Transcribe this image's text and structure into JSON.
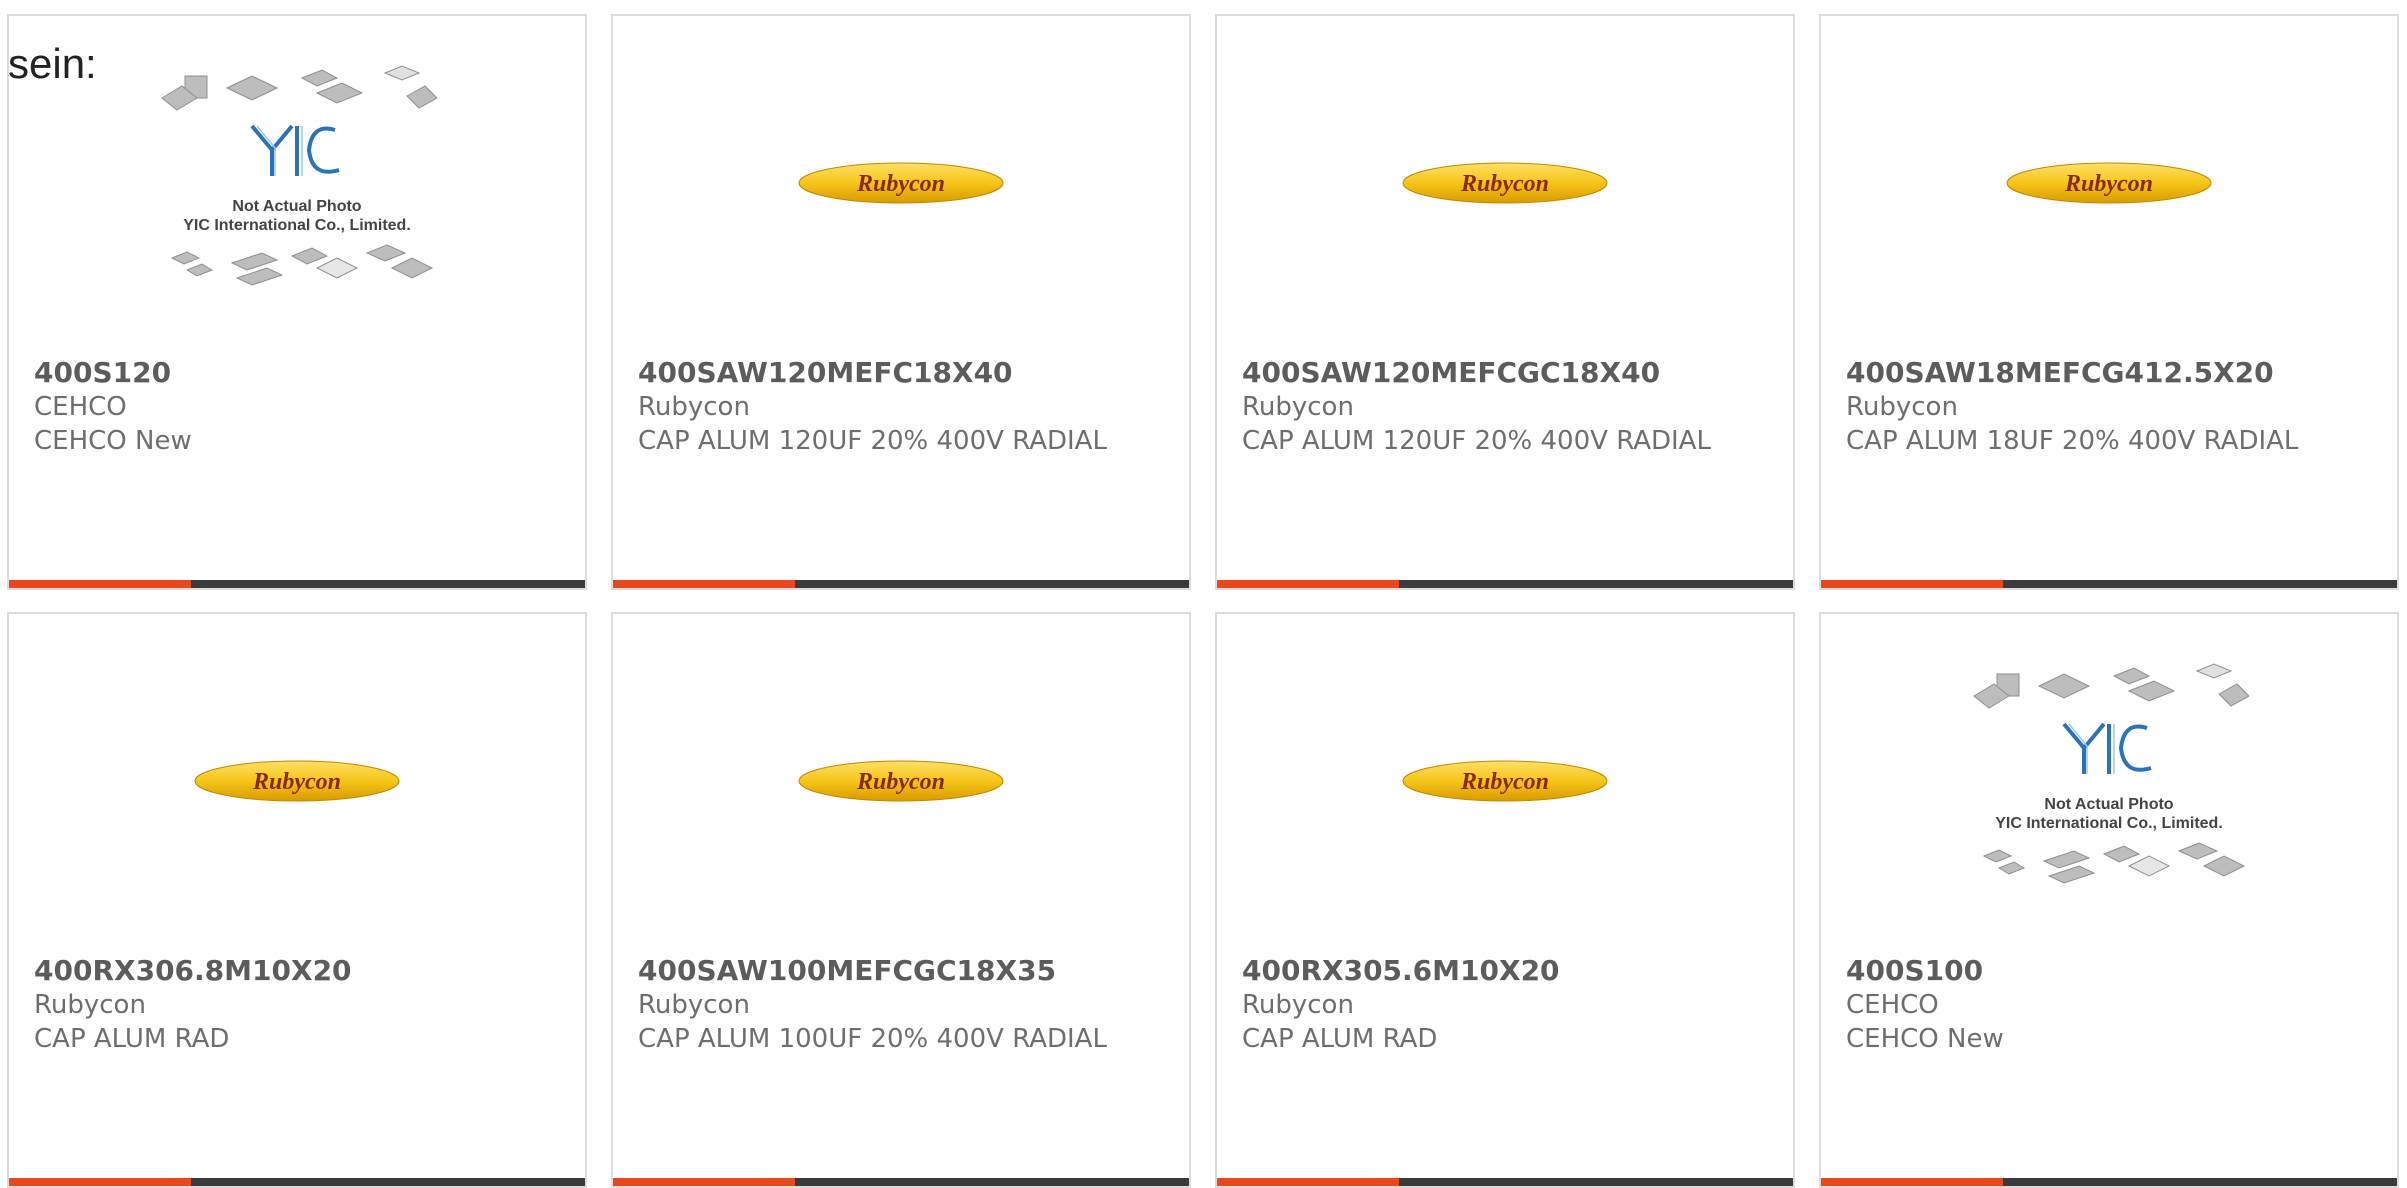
{
  "page": {
    "label": "sein:"
  },
  "colors": {
    "accent": "#e8481c",
    "bar": "#3b3b3b",
    "rubycon_yellow": "#f5c518",
    "rubycon_text": "#8a2a12",
    "yic_blue": "#2b73b8"
  },
  "products": [
    {
      "part_number": "400S120",
      "manufacturer": "CEHCO",
      "description": "CEHCO New",
      "image": "yic-placeholder"
    },
    {
      "part_number": "400SAW120MEFC18X40",
      "manufacturer": "Rubycon",
      "description": "CAP ALUM 120UF 20% 400V RADIAL",
      "image": "rubycon-logo"
    },
    {
      "part_number": "400SAW120MEFCGC18X40",
      "manufacturer": "Rubycon",
      "description": "CAP ALUM 120UF 20% 400V RADIAL",
      "image": "rubycon-logo"
    },
    {
      "part_number": "400SAW18MEFCG412.5X20",
      "manufacturer": "Rubycon",
      "description": "CAP ALUM 18UF 20% 400V RADIAL",
      "image": "rubycon-logo"
    },
    {
      "part_number": "400RX306.8M10X20",
      "manufacturer": "Rubycon",
      "description": "CAP ALUM RAD",
      "image": "rubycon-logo"
    },
    {
      "part_number": "400SAW100MEFCGC18X35",
      "manufacturer": "Rubycon",
      "description": "CAP ALUM 100UF 20% 400V RADIAL",
      "image": "rubycon-logo"
    },
    {
      "part_number": "400RX305.6M10X20",
      "manufacturer": "Rubycon",
      "description": "CAP ALUM RAD",
      "image": "rubycon-logo"
    },
    {
      "part_number": "400S100",
      "manufacturer": "CEHCO",
      "description": "CEHCO New",
      "image": "yic-placeholder"
    }
  ],
  "logos": {
    "rubycon_text": "Rubycon",
    "yic_text": "YIC",
    "yic_caption_1": "Not Actual Photo",
    "yic_caption_2": "YIC International Co., Limited."
  }
}
